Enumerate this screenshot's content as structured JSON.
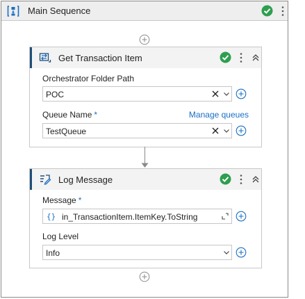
{
  "sequence": {
    "title": "Main Sequence",
    "icon": "sequence-icon",
    "status": "valid"
  },
  "activities": [
    {
      "title": "Get Transaction Item",
      "icon": "get-transaction-icon",
      "status": "valid",
      "fields": {
        "folder_label": "Orchestrator Folder Path",
        "folder_value": "POC",
        "queue_label": "Queue Name",
        "queue_required": "*",
        "queue_link": "Manage queues",
        "queue_value": "TestQueue"
      }
    },
    {
      "title": "Log Message",
      "icon": "log-message-icon",
      "status": "valid",
      "fields": {
        "message_label": "Message",
        "message_required": "*",
        "message_expr": "{}",
        "message_value": "in_TransactionItem.ItemKey.ToString",
        "level_label": "Log Level",
        "level_value": "Info"
      }
    }
  ],
  "colors": {
    "accent": "#1a6fc4",
    "valid": "#2e9e4f",
    "card_bar": "#1f4e79"
  }
}
